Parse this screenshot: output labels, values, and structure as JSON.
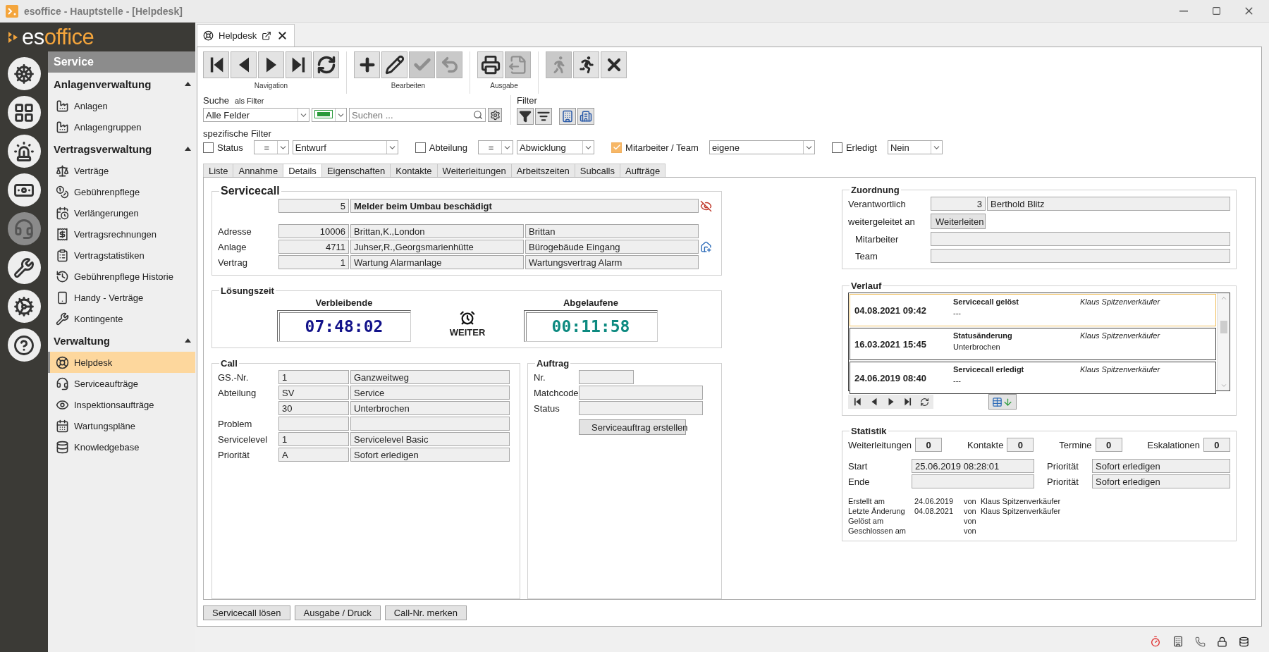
{
  "window": {
    "title": "esoffice - Hauptstelle - [Helpdesk]"
  },
  "logo": {
    "prefix": "es",
    "suffix": "office"
  },
  "rail": [
    {
      "kind": "helm",
      "selected": false
    },
    {
      "kind": "board",
      "selected": false
    },
    {
      "kind": "siren",
      "selected": false
    },
    {
      "kind": "money",
      "selected": false
    },
    {
      "kind": "headset",
      "selected": true
    },
    {
      "kind": "tools",
      "selected": false
    },
    {
      "kind": "gears",
      "selected": false
    },
    {
      "kind": "help",
      "selected": false
    }
  ],
  "sidebar": {
    "title": "Service",
    "groups": [
      {
        "title": "Anlagenverwaltung",
        "expanded": true,
        "items": [
          {
            "label": "Anlagen",
            "kind": "machine",
            "selected": false
          },
          {
            "label": "Anlagengruppen",
            "kind": "machines",
            "selected": false
          }
        ]
      },
      {
        "title": "Vertragsverwaltung",
        "expanded": true,
        "items": [
          {
            "label": "Verträge",
            "kind": "paragraph",
            "selected": false
          },
          {
            "label": "Gebührenpflege",
            "kind": "money-bag",
            "selected": false
          },
          {
            "label": "Verlängerungen",
            "kind": "renewal",
            "selected": false
          },
          {
            "label": "Vertragsrechnungen",
            "kind": "invoice",
            "selected": false
          },
          {
            "label": "Vertragstatistiken",
            "kind": "statistics",
            "selected": false
          },
          {
            "label": "Gebührenpflege Historie",
            "kind": "history",
            "selected": false
          },
          {
            "label": "Handy - Verträge",
            "kind": "phone",
            "selected": false
          },
          {
            "label": "Kontingente",
            "kind": "tools",
            "selected": false
          }
        ]
      },
      {
        "title": "Verwaltung",
        "expanded": true,
        "items": [
          {
            "label": "Helpdesk",
            "kind": "lifebuoy",
            "selected": true
          },
          {
            "label": "Serviceaufträge",
            "kind": "headset",
            "selected": false
          },
          {
            "label": "Inspektionsaufträge",
            "kind": "eye",
            "selected": false
          },
          {
            "label": "Wartungspläne",
            "kind": "calendar",
            "selected": false
          },
          {
            "label": "Knowledgebase",
            "kind": "database",
            "selected": false
          }
        ]
      }
    ]
  },
  "document_tab": {
    "label": "Helpdesk"
  },
  "toolbar": [
    {
      "label": "Navigation",
      "buttons": [
        {
          "kind": "first",
          "disabled": false
        },
        {
          "kind": "previous",
          "disabled": false
        },
        {
          "kind": "next",
          "disabled": false
        },
        {
          "kind": "last",
          "disabled": false
        },
        {
          "kind": "refresh",
          "disabled": false
        }
      ]
    },
    {
      "label": "Bearbeiten",
      "buttons": [
        {
          "kind": "add",
          "disabled": false
        },
        {
          "kind": "edit",
          "disabled": false
        },
        {
          "kind": "save",
          "disabled": true
        },
        {
          "kind": "undo",
          "disabled": true
        }
      ]
    },
    {
      "label": "Ausgabe",
      "buttons": [
        {
          "kind": "print",
          "disabled": false
        },
        {
          "kind": "export",
          "disabled": true
        }
      ]
    },
    {
      "buttons": [
        {
          "kind": "walk",
          "disabled": true
        },
        {
          "kind": "run",
          "disabled": false
        },
        {
          "kind": "close",
          "disabled": false
        }
      ]
    }
  ],
  "search": {
    "label": "Suche",
    "hint": "als Filter",
    "field": "Alle Felder",
    "placeholder": "Suchen ..."
  },
  "filter": {
    "label": "Filter",
    "buttons": [
      {
        "kind": "filter-edit"
      },
      {
        "kind": "filter-check"
      },
      {
        "kind": "org-filter"
      },
      {
        "kind": "org-filter-multi"
      }
    ]
  },
  "specific_filters": {
    "title": "spezifische Filter",
    "items": [
      {
        "label": "Status",
        "checked": false,
        "operator": "=",
        "value": "Entwurf"
      },
      {
        "label": "Abteilung",
        "checked": false,
        "operator": "=",
        "value": "Abwicklung"
      },
      {
        "label": "Mitarbeiter / Team",
        "checked": true,
        "value": "eigene"
      },
      {
        "label": "Erledigt",
        "checked": false,
        "value": "Nein"
      }
    ]
  },
  "tabs": [
    {
      "label": "Liste",
      "selected": false
    },
    {
      "label": "Annahme",
      "selected": false
    },
    {
      "label": "Details",
      "selected": true
    },
    {
      "label": "Eigenschaften",
      "selected": false
    },
    {
      "label": "Kontakte",
      "selected": false
    },
    {
      "label": "Weiterleitungen",
      "selected": false
    },
    {
      "label": "Arbeitszeiten",
      "selected": false
    },
    {
      "label": "Subcalls",
      "selected": false
    },
    {
      "label": "Aufträge",
      "selected": false
    }
  ],
  "servicecall": {
    "title": "Servicecall",
    "number": "5",
    "subject": "Melder beim Umbau beschädigt",
    "rows": [
      {
        "label": "Adresse",
        "number": "10006",
        "name": "Brittan,K.,London",
        "detail": "Brittan"
      },
      {
        "label": "Anlage",
        "number": "4711",
        "name": "Juhser,R.,Georgsmarienhütte",
        "detail": "Bürogebäude Eingang",
        "kind": "building-alert"
      },
      {
        "label": "Vertrag",
        "number": "1",
        "name": "Wartung Alarmanlage",
        "detail": "Wartungsvertrag Alarm"
      }
    ]
  },
  "solution_time": {
    "title": "Lösungszeit",
    "remaining_label": "Verbleibende",
    "remaining": "07:48:02",
    "status": "WEITER",
    "elapsed_label": "Abgelaufene",
    "elapsed": "00:11:58"
  },
  "call": {
    "title": "Call",
    "rows": [
      {
        "label": "GS.-Nr.",
        "code": "1",
        "value": "Ganzweitweg"
      },
      {
        "label": "Abteilung",
        "code": "SV",
        "value": "Service"
      },
      {
        "code": "30",
        "value": "Unterbrochen"
      },
      {
        "label": "Problem"
      },
      {
        "label": "Servicelevel",
        "code": "1",
        "value": "Servicelevel Basic"
      },
      {
        "label": "Priorität",
        "code": "A",
        "value": "Sofort erledigen"
      }
    ]
  },
  "order": {
    "title": "Auftrag",
    "fields": [
      {
        "label": "Nr."
      },
      {
        "label": "Matchcode"
      },
      {
        "label": "Status"
      }
    ],
    "button": "Serviceauftrag erstellen"
  },
  "assignment": {
    "title": "Zuordnung",
    "responsible_label": "Verantwortlich",
    "responsible_number": "3",
    "responsible_name": "Berthold Blitz",
    "forwarded_label": "weitergeleitet an",
    "forward_button": "Weiterleiten",
    "fields": [
      {
        "label": "Mitarbeiter"
      },
      {
        "label": "Team"
      }
    ]
  },
  "history": {
    "title": "Verlauf",
    "entries": [
      {
        "date": "04.08.2021 09:42",
        "event": "Servicecall gelöst",
        "note": "---",
        "user": "Klaus Spitzenverkäufer",
        "selected": true
      },
      {
        "date": "16.03.2021 15:45",
        "event": "Statusänderung",
        "note": "Unterbrochen",
        "user": "Klaus Spitzenverkäufer",
        "selected": false
      },
      {
        "date": "24.06.2019 08:40",
        "event": "Servicecall erledigt",
        "note": "---",
        "user": "Klaus Spitzenverkäufer",
        "selected": false
      }
    ]
  },
  "statistics": {
    "title": "Statistik",
    "counters": [
      {
        "label": "Weiterleitungen",
        "value": "0"
      },
      {
        "label": "Kontakte",
        "value": "0"
      },
      {
        "label": "Termine",
        "value": "0"
      },
      {
        "label": "Eskalationen",
        "value": "0"
      }
    ],
    "start_label": "Start",
    "start": "25.06.2019 08:28:01",
    "end_label": "Ende",
    "priorities": [
      {
        "label": "Priorität",
        "value": "Sofort erledigen"
      },
      {
        "label": "Priorität",
        "value": "Sofort erledigen"
      }
    ],
    "audit": [
      {
        "label": "Erstellt am",
        "date": "24.06.2019",
        "by": "von",
        "user": "Klaus Spitzenverkäufer"
      },
      {
        "label": "Letzte Änderung",
        "date": "04.08.2021",
        "by": "von",
        "user": "Klaus Spitzenverkäufer"
      },
      {
        "label": "Gelöst am",
        "by": "von"
      },
      {
        "label": "Geschlossen am",
        "by": "von"
      }
    ]
  },
  "actions": [
    "Servicecall lösen",
    "Ausgabe / Druck",
    "Call-Nr. merken"
  ]
}
